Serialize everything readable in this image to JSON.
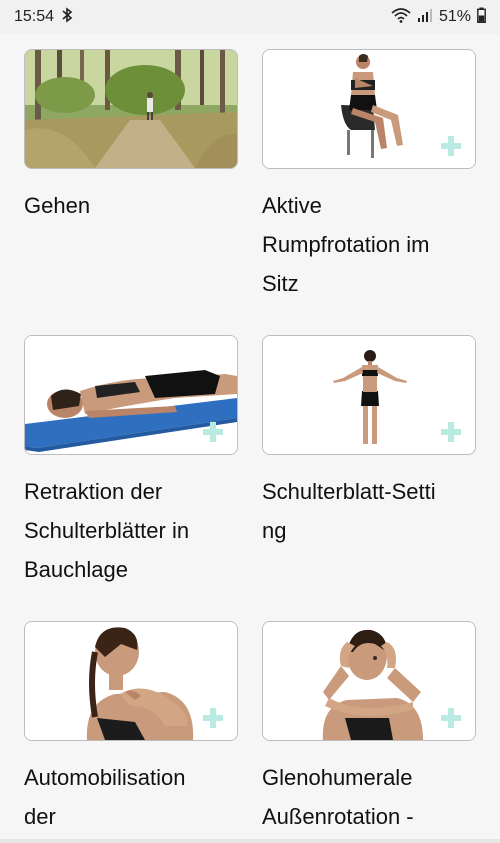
{
  "status_bar": {
    "time": "15:54",
    "battery": "51%",
    "icons": [
      "bluetooth-icon",
      "wifi-icon",
      "signal-icon",
      "battery-icon"
    ]
  },
  "exercises": [
    {
      "title": "Gehen",
      "image": "walking-forest-photo"
    },
    {
      "title": "Aktive\nRumpfrotation im\nSitz",
      "image": "seated-trunk-rotation"
    },
    {
      "title": "Retraktion der\nSchulterblätter in\nBauchlage",
      "image": "prone-scapula-retraction"
    },
    {
      "title": "Schulterblatt-Setti\nng",
      "image": "scapula-setting"
    },
    {
      "title": "Automobilisation\nder",
      "image": "self-mobilisation"
    },
    {
      "title": "Glenohumerale\nAußenrotation -",
      "image": "glenohumeral-external-rotation"
    }
  ],
  "colors": {
    "plus_accent": "#b9ebe3",
    "background": "#f6f6f6"
  }
}
